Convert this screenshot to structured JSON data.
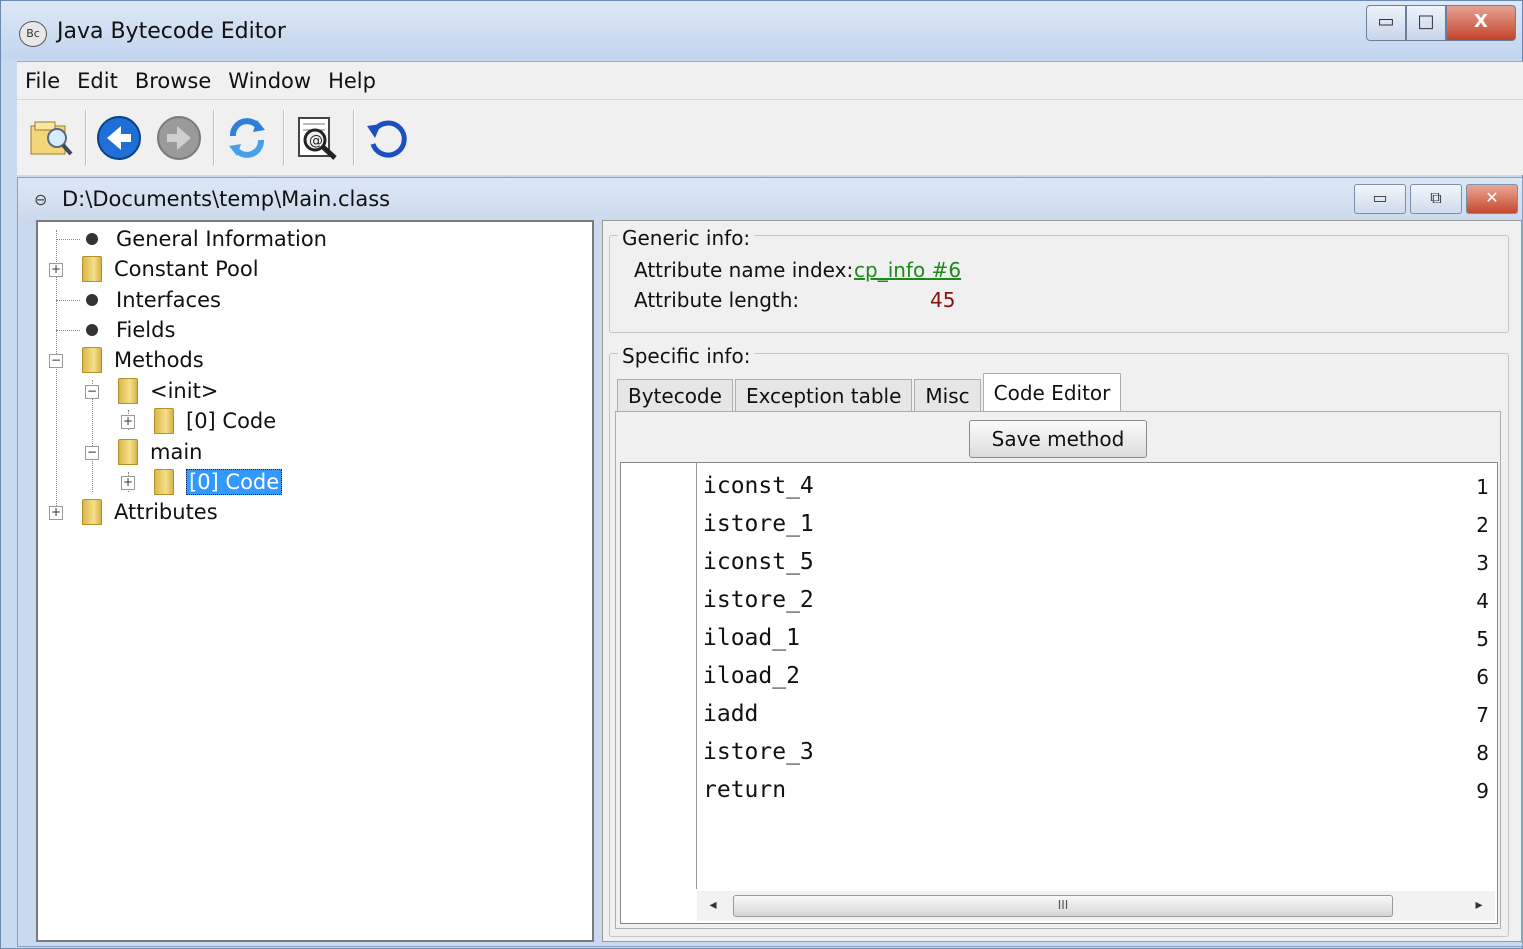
{
  "window": {
    "title": "Java Bytecode Editor",
    "controls": {
      "minimize": "▭",
      "maximize": "□",
      "close": "X"
    }
  },
  "menu": [
    "File",
    "Edit",
    "Browse",
    "Window",
    "Help"
  ],
  "toolbar": {
    "icons": [
      "open-file-icon",
      "back-icon",
      "forward-icon",
      "refresh-icon",
      "search-icon",
      "reload-icon"
    ]
  },
  "document": {
    "title": "D:\\Documents\\temp\\Main.class"
  },
  "tree": {
    "general_information": "General Information",
    "constant_pool": "Constant Pool",
    "interfaces": "Interfaces",
    "fields": "Fields",
    "methods": "Methods",
    "init": "<init>",
    "init_code": "[0] Code",
    "main": "main",
    "main_code": "[0] Code",
    "attributes": "Attributes"
  },
  "generic_info": {
    "label": "Generic info:",
    "attr_name_label": "Attribute name index:",
    "attr_name_value": "cp_info #6",
    "attr_length_label": "Attribute length:",
    "attr_length_value": "45"
  },
  "specific_info": {
    "label": "Specific info:",
    "tabs": [
      "Bytecode",
      "Exception table",
      "Misc",
      "Code Editor"
    ],
    "active_tab": "Code Editor",
    "save_label": "Save method"
  },
  "code": {
    "line_numbers": [
      "1",
      "2",
      "3",
      "4",
      "5",
      "6",
      "7",
      "8",
      "9"
    ],
    "lines": [
      "iconst_4",
      "istore_1",
      "iconst_5",
      "istore_2",
      "iload_1",
      "iload_2",
      "iadd",
      "istore_3",
      "return"
    ]
  },
  "scroll": {
    "thumb_grip": "III",
    "left_arrow": "◂",
    "right_arrow": "▸"
  }
}
